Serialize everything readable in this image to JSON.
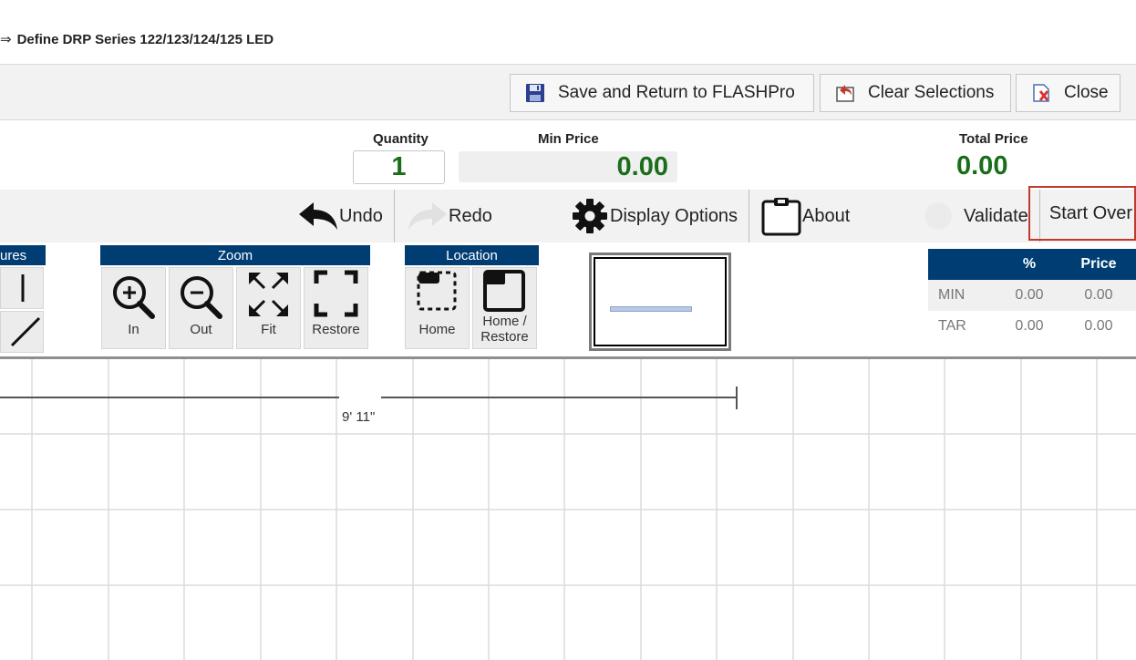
{
  "title": {
    "arrow": "⇒",
    "text": "Define DRP Series 122/123/124/125 LED"
  },
  "header": {
    "save_label": "Save and Return to FLASHPro",
    "clear_label": "Clear Selections",
    "close_label": "Close"
  },
  "pricing": {
    "quantity_label": "Quantity",
    "quantity_value": "1",
    "min_price_label": "Min Price",
    "min_price_value": "0.00",
    "total_price_label": "Total Price",
    "total_price_value": "0.00"
  },
  "actions": {
    "undo": "Undo",
    "redo": "Redo",
    "display_options": "Display Options",
    "about": "About",
    "validate": "Validate",
    "start_over": "Start Over"
  },
  "panels": {
    "features_title": "ures",
    "zoom_title": "Zoom",
    "zoom_in": "In",
    "zoom_out": "Out",
    "zoom_fit": "Fit",
    "zoom_restore": "Restore",
    "location_title": "Location",
    "location_home": "Home",
    "location_home_restore": "Home / Restore"
  },
  "price_table": {
    "headers": [
      "",
      "%",
      "Price"
    ],
    "rows": [
      {
        "label": "MIN",
        "pct": "0.00",
        "price": "0.00"
      },
      {
        "label": "TAR",
        "pct": "0.00",
        "price": "0.00"
      }
    ]
  },
  "canvas": {
    "dimension_label": "9' 11\""
  },
  "colors": {
    "panel_header": "#003d73",
    "price_green": "#1a6e1a",
    "highlight_border": "#c0392b"
  }
}
